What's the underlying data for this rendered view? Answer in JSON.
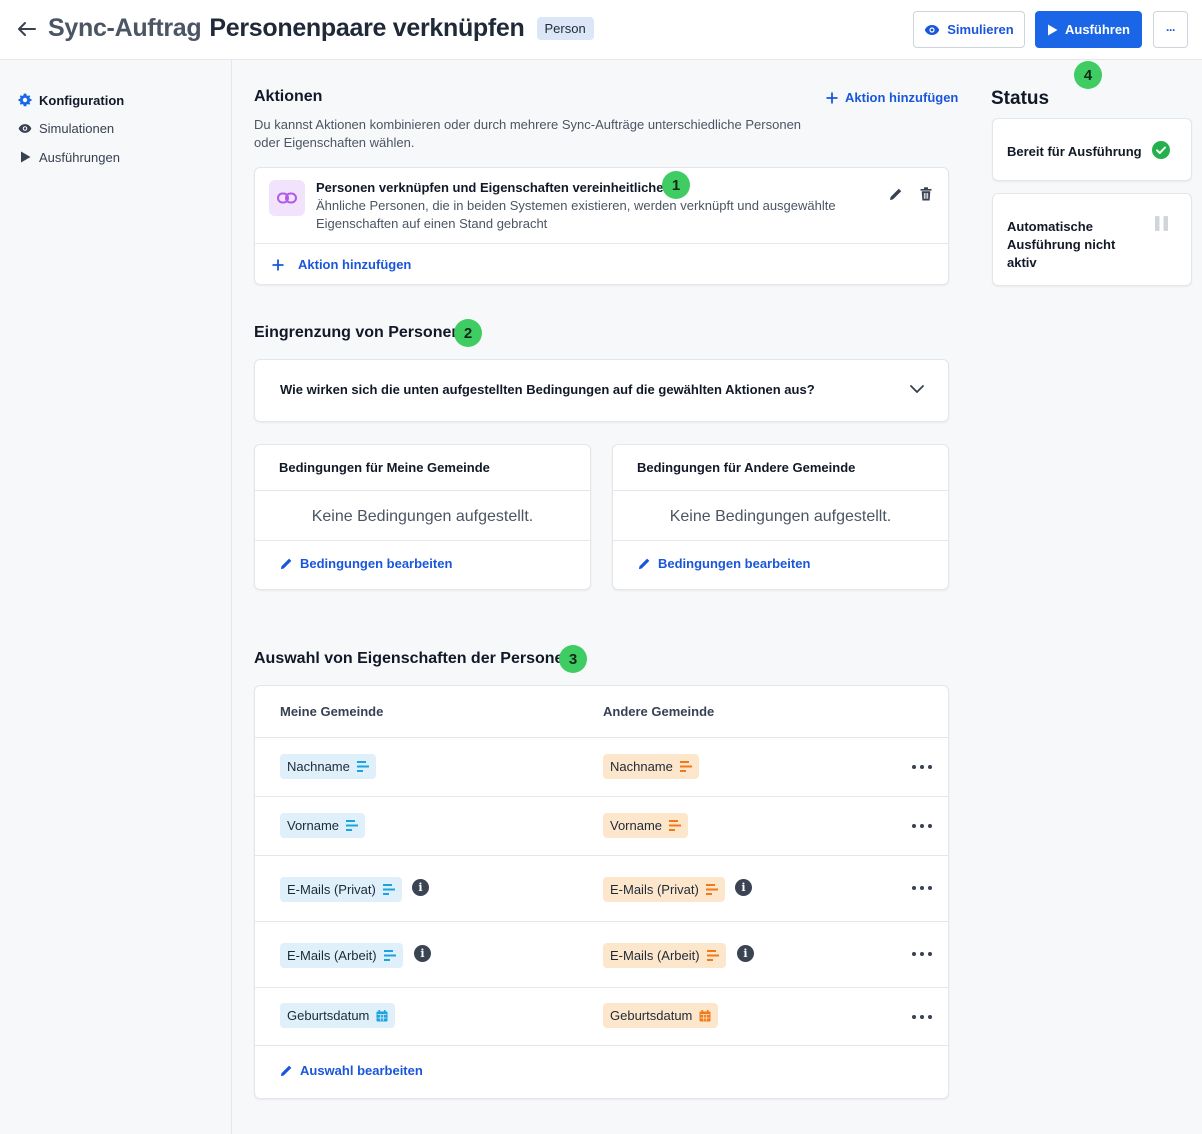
{
  "header": {
    "title_prefix": "Sync-Auftrag",
    "title_main": "Personenpaare verknüpfen",
    "badge": "Person",
    "simulate_label": "Simulieren",
    "run_label": "Ausführen",
    "more_label": "···"
  },
  "sidebar": {
    "items": [
      {
        "label": "Konfiguration",
        "icon": "gear-icon",
        "active": true
      },
      {
        "label": "Simulationen",
        "icon": "eye-icon",
        "active": false
      },
      {
        "label": "Ausführungen",
        "icon": "play-icon",
        "active": false
      }
    ]
  },
  "actions": {
    "title": "Aktionen",
    "add_link": "Aktion hinzufügen",
    "description": "Du kannst Aktionen kombinieren oder durch mehrere Sync-Aufträge unterschiedliche Personen oder Eigenschaften wählen.",
    "item_title": "Personen verknüpfen und Eigenschaften vereinheitlichen",
    "item_description": "Ähnliche Personen, die in beiden Systemen existieren, werden verknüpft und ausgewählte Eigenschaften auf einen Stand gebracht",
    "card_add_link": "Aktion hinzufügen"
  },
  "steps": [
    "1",
    "2",
    "3",
    "4"
  ],
  "filter": {
    "title": "Eingrenzung von Personen",
    "accordion_question": "Wie wirken sich die unten aufgestellten Bedingungen auf die gewählten Aktionen aus?",
    "left": {
      "title": "Bedingungen für Meine Gemeinde",
      "empty": "Keine Bedingungen aufgestellt.",
      "edit_link": "Bedingungen bearbeiten"
    },
    "right": {
      "title": "Bedingungen für Andere Gemeinde",
      "empty": "Keine Bedingungen aufgestellt.",
      "edit_link": "Bedingungen bearbeiten"
    }
  },
  "properties": {
    "title": "Auswahl von Eigenschaften der Personen",
    "col_left": "Meine Gemeinde",
    "col_right": "Andere Gemeinde",
    "rows": [
      {
        "left": "Nachname",
        "right": "Nachname",
        "icon": "text-lines-icon",
        "info": false
      },
      {
        "left": "Vorname",
        "right": "Vorname",
        "icon": "text-lines-icon",
        "info": false
      },
      {
        "left": "E-Mails (Privat)",
        "right": "E-Mails (Privat)",
        "icon": "text-lines-icon",
        "info": true
      },
      {
        "left": "E-Mails (Arbeit)",
        "right": "E-Mails (Arbeit)",
        "icon": "text-lines-icon",
        "info": true
      },
      {
        "left": "Geburtsdatum",
        "right": "Geburtsdatum",
        "icon": "calendar-icon",
        "info": false
      }
    ],
    "edit_link": "Auswahl bearbeiten"
  },
  "status": {
    "title": "Status",
    "ready_label": "Bereit für Ausführung",
    "auto_label": "Automatische Ausführung nicht aktiv"
  },
  "colors": {
    "accent": "#1a66e6",
    "step_green": "#3ecc63",
    "pill_blue": "#dff0fb",
    "pill_orange": "#fde7cc",
    "icon_blue": "#1aa3e0",
    "icon_orange": "#f07a1a",
    "check_green": "#22b14c"
  }
}
